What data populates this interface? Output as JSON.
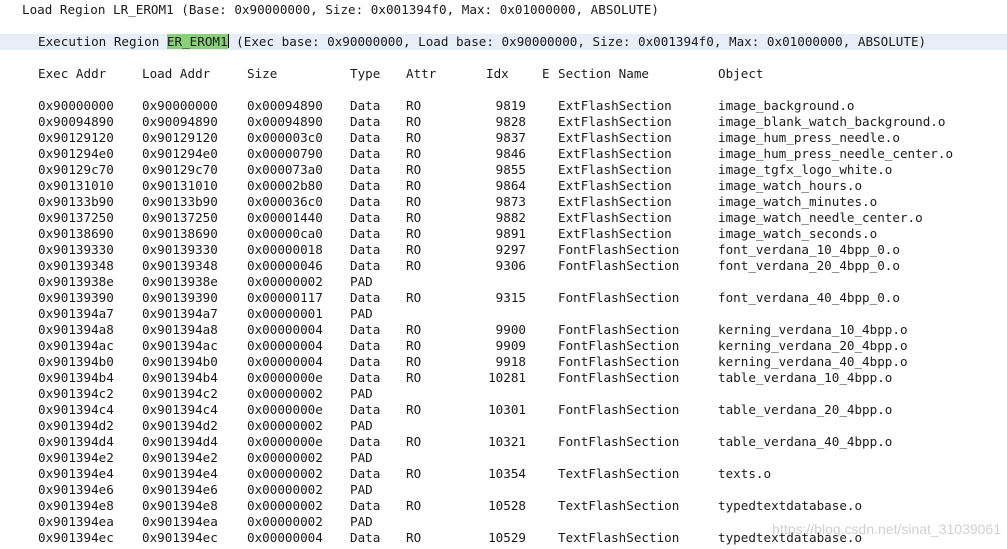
{
  "load_region": {
    "prefix": "Load Region ",
    "name": "LR_EROM1",
    "rest": " (Base: 0x90000000, Size: 0x001394f0, Max: 0x01000000, ABSOLUTE)"
  },
  "exec_region": {
    "prefix": "Execution Region ",
    "name": "ER_EROM1",
    "rest": " (Exec base: 0x90000000, Load base: 0x90000000, Size: 0x001394f0, Max: 0x01000000, ABSOLUTE)"
  },
  "columns": {
    "exec_addr": "Exec Addr",
    "load_addr": "Load Addr",
    "size": "Size",
    "type": "Type",
    "attr": "Attr",
    "idx": "Idx",
    "e": "E",
    "section": "Section Name",
    "object": "Object"
  },
  "rows": [
    {
      "exec": "0x90000000",
      "load": "0x90000000",
      "size": "0x00094890",
      "type": "Data",
      "attr": "RO",
      "idx": "9819",
      "section": "ExtFlashSection",
      "object": "image_background.o"
    },
    {
      "exec": "0x90094890",
      "load": "0x90094890",
      "size": "0x00094890",
      "type": "Data",
      "attr": "RO",
      "idx": "9828",
      "section": "ExtFlashSection",
      "object": "image_blank_watch_background.o"
    },
    {
      "exec": "0x90129120",
      "load": "0x90129120",
      "size": "0x000003c0",
      "type": "Data",
      "attr": "RO",
      "idx": "9837",
      "section": "ExtFlashSection",
      "object": "image_hum_press_needle.o"
    },
    {
      "exec": "0x901294e0",
      "load": "0x901294e0",
      "size": "0x00000790",
      "type": "Data",
      "attr": "RO",
      "idx": "9846",
      "section": "ExtFlashSection",
      "object": "image_hum_press_needle_center.o"
    },
    {
      "exec": "0x90129c70",
      "load": "0x90129c70",
      "size": "0x000073a0",
      "type": "Data",
      "attr": "RO",
      "idx": "9855",
      "section": "ExtFlashSection",
      "object": "image_tgfx_logo_white.o"
    },
    {
      "exec": "0x90131010",
      "load": "0x90131010",
      "size": "0x00002b80",
      "type": "Data",
      "attr": "RO",
      "idx": "9864",
      "section": "ExtFlashSection",
      "object": "image_watch_hours.o"
    },
    {
      "exec": "0x90133b90",
      "load": "0x90133b90",
      "size": "0x000036c0",
      "type": "Data",
      "attr": "RO",
      "idx": "9873",
      "section": "ExtFlashSection",
      "object": "image_watch_minutes.o"
    },
    {
      "exec": "0x90137250",
      "load": "0x90137250",
      "size": "0x00001440",
      "type": "Data",
      "attr": "RO",
      "idx": "9882",
      "section": "ExtFlashSection",
      "object": "image_watch_needle_center.o"
    },
    {
      "exec": "0x90138690",
      "load": "0x90138690",
      "size": "0x00000ca0",
      "type": "Data",
      "attr": "RO",
      "idx": "9891",
      "section": "ExtFlashSection",
      "object": "image_watch_seconds.o"
    },
    {
      "exec": "0x90139330",
      "load": "0x90139330",
      "size": "0x00000018",
      "type": "Data",
      "attr": "RO",
      "idx": "9297",
      "section": "FontFlashSection",
      "object": "font_verdana_10_4bpp_0.o"
    },
    {
      "exec": "0x90139348",
      "load": "0x90139348",
      "size": "0x00000046",
      "type": "Data",
      "attr": "RO",
      "idx": "9306",
      "section": "FontFlashSection",
      "object": "font_verdana_20_4bpp_0.o"
    },
    {
      "exec": "0x9013938e",
      "load": "0x9013938e",
      "size": "0x00000002",
      "type": "PAD",
      "attr": "",
      "idx": "",
      "section": "",
      "object": ""
    },
    {
      "exec": "0x90139390",
      "load": "0x90139390",
      "size": "0x00000117",
      "type": "Data",
      "attr": "RO",
      "idx": "9315",
      "section": "FontFlashSection",
      "object": "font_verdana_40_4bpp_0.o"
    },
    {
      "exec": "0x901394a7",
      "load": "0x901394a7",
      "size": "0x00000001",
      "type": "PAD",
      "attr": "",
      "idx": "",
      "section": "",
      "object": ""
    },
    {
      "exec": "0x901394a8",
      "load": "0x901394a8",
      "size": "0x00000004",
      "type": "Data",
      "attr": "RO",
      "idx": "9900",
      "section": "FontFlashSection",
      "object": "kerning_verdana_10_4bpp.o"
    },
    {
      "exec": "0x901394ac",
      "load": "0x901394ac",
      "size": "0x00000004",
      "type": "Data",
      "attr": "RO",
      "idx": "9909",
      "section": "FontFlashSection",
      "object": "kerning_verdana_20_4bpp.o"
    },
    {
      "exec": "0x901394b0",
      "load": "0x901394b0",
      "size": "0x00000004",
      "type": "Data",
      "attr": "RO",
      "idx": "9918",
      "section": "FontFlashSection",
      "object": "kerning_verdana_40_4bpp.o"
    },
    {
      "exec": "0x901394b4",
      "load": "0x901394b4",
      "size": "0x0000000e",
      "type": "Data",
      "attr": "RO",
      "idx": "10281",
      "section": "FontFlashSection",
      "object": "table_verdana_10_4bpp.o"
    },
    {
      "exec": "0x901394c2",
      "load": "0x901394c2",
      "size": "0x00000002",
      "type": "PAD",
      "attr": "",
      "idx": "",
      "section": "",
      "object": ""
    },
    {
      "exec": "0x901394c4",
      "load": "0x901394c4",
      "size": "0x0000000e",
      "type": "Data",
      "attr": "RO",
      "idx": "10301",
      "section": "FontFlashSection",
      "object": "table_verdana_20_4bpp.o"
    },
    {
      "exec": "0x901394d2",
      "load": "0x901394d2",
      "size": "0x00000002",
      "type": "PAD",
      "attr": "",
      "idx": "",
      "section": "",
      "object": ""
    },
    {
      "exec": "0x901394d4",
      "load": "0x901394d4",
      "size": "0x0000000e",
      "type": "Data",
      "attr": "RO",
      "idx": "10321",
      "section": "FontFlashSection",
      "object": "table_verdana_40_4bpp.o"
    },
    {
      "exec": "0x901394e2",
      "load": "0x901394e2",
      "size": "0x00000002",
      "type": "PAD",
      "attr": "",
      "idx": "",
      "section": "",
      "object": ""
    },
    {
      "exec": "0x901394e4",
      "load": "0x901394e4",
      "size": "0x00000002",
      "type": "Data",
      "attr": "RO",
      "idx": "10354",
      "section": "TextFlashSection",
      "object": "texts.o"
    },
    {
      "exec": "0x901394e6",
      "load": "0x901394e6",
      "size": "0x00000002",
      "type": "PAD",
      "attr": "",
      "idx": "",
      "section": "",
      "object": ""
    },
    {
      "exec": "0x901394e8",
      "load": "0x901394e8",
      "size": "0x00000002",
      "type": "Data",
      "attr": "RO",
      "idx": "10528",
      "section": "TextFlashSection",
      "object": "typedtextdatabase.o"
    },
    {
      "exec": "0x901394ea",
      "load": "0x901394ea",
      "size": "0x00000002",
      "type": "PAD",
      "attr": "",
      "idx": "",
      "section": "",
      "object": ""
    },
    {
      "exec": "0x901394ec",
      "load": "0x901394ec",
      "size": "0x00000004",
      "type": "Data",
      "attr": "RO",
      "idx": "10529",
      "section": "TextFlashSection",
      "object": "typedtextdatabase.o"
    }
  ],
  "watermark": "https://blog.csdn.net/sinat_31039061",
  "colors": {
    "selection_highlight": "#8ad07a",
    "current_line": "#e8eef8"
  }
}
